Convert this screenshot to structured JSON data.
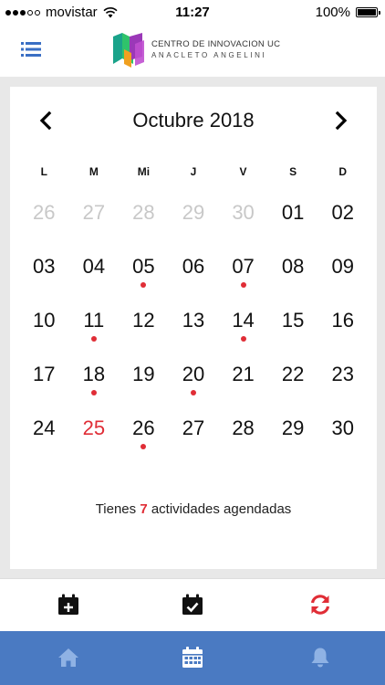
{
  "status_bar": {
    "carrier": "movistar",
    "time": "11:27",
    "battery": "100%",
    "signal_bars_filled": 3,
    "signal_bars_total": 5,
    "battery_level": 1.0
  },
  "header": {
    "menu_icon": "list-menu-icon",
    "logo": {
      "line1": "CENTRO DE INNOVACION UC",
      "line2": "ANACLETO ANGELINI"
    }
  },
  "calendar": {
    "month_title": "Octubre 2018",
    "prev_icon": "chevron-left-icon",
    "next_icon": "chevron-right-icon",
    "weekdays": [
      "L",
      "M",
      "Mi",
      "J",
      "V",
      "S",
      "D"
    ],
    "days": [
      {
        "label": "26",
        "muted": true,
        "event": false,
        "today": false
      },
      {
        "label": "27",
        "muted": true,
        "event": false,
        "today": false
      },
      {
        "label": "28",
        "muted": true,
        "event": false,
        "today": false
      },
      {
        "label": "29",
        "muted": true,
        "event": false,
        "today": false
      },
      {
        "label": "30",
        "muted": true,
        "event": false,
        "today": false
      },
      {
        "label": "01",
        "muted": false,
        "event": false,
        "today": false
      },
      {
        "label": "02",
        "muted": false,
        "event": false,
        "today": false
      },
      {
        "label": "03",
        "muted": false,
        "event": false,
        "today": false
      },
      {
        "label": "04",
        "muted": false,
        "event": false,
        "today": false
      },
      {
        "label": "05",
        "muted": false,
        "event": true,
        "today": false
      },
      {
        "label": "06",
        "muted": false,
        "event": false,
        "today": false
      },
      {
        "label": "07",
        "muted": false,
        "event": true,
        "today": false
      },
      {
        "label": "08",
        "muted": false,
        "event": false,
        "today": false
      },
      {
        "label": "09",
        "muted": false,
        "event": false,
        "today": false
      },
      {
        "label": "10",
        "muted": false,
        "event": false,
        "today": false
      },
      {
        "label": "11",
        "muted": false,
        "event": true,
        "today": false
      },
      {
        "label": "12",
        "muted": false,
        "event": false,
        "today": false
      },
      {
        "label": "13",
        "muted": false,
        "event": false,
        "today": false
      },
      {
        "label": "14",
        "muted": false,
        "event": true,
        "today": false
      },
      {
        "label": "15",
        "muted": false,
        "event": false,
        "today": false
      },
      {
        "label": "16",
        "muted": false,
        "event": false,
        "today": false
      },
      {
        "label": "17",
        "muted": false,
        "event": false,
        "today": false
      },
      {
        "label": "18",
        "muted": false,
        "event": true,
        "today": false
      },
      {
        "label": "19",
        "muted": false,
        "event": false,
        "today": false
      },
      {
        "label": "20",
        "muted": false,
        "event": true,
        "today": false
      },
      {
        "label": "21",
        "muted": false,
        "event": false,
        "today": false
      },
      {
        "label": "22",
        "muted": false,
        "event": false,
        "today": false
      },
      {
        "label": "23",
        "muted": false,
        "event": false,
        "today": false
      },
      {
        "label": "24",
        "muted": false,
        "event": false,
        "today": false
      },
      {
        "label": "25",
        "muted": false,
        "event": false,
        "today": true
      },
      {
        "label": "26",
        "muted": false,
        "event": true,
        "today": false
      },
      {
        "label": "27",
        "muted": false,
        "event": false,
        "today": false
      },
      {
        "label": "28",
        "muted": false,
        "event": false,
        "today": false
      },
      {
        "label": "29",
        "muted": false,
        "event": false,
        "today": false
      },
      {
        "label": "30",
        "muted": false,
        "event": false,
        "today": false
      }
    ],
    "summary": {
      "prefix": "Tienes",
      "count": "7",
      "suffix": "actividades agendadas"
    }
  },
  "actions": [
    {
      "icon": "calendar-add-icon",
      "color": "#111111"
    },
    {
      "icon": "calendar-check-icon",
      "color": "#111111"
    },
    {
      "icon": "refresh-icon",
      "color": "#e02d36"
    }
  ],
  "tabbar": {
    "background": "#4a7ac2",
    "tabs": [
      {
        "icon": "home-icon",
        "active": false
      },
      {
        "icon": "calendar-icon",
        "active": true
      },
      {
        "icon": "bell-icon",
        "active": false
      }
    ]
  },
  "colors": {
    "accent": "#e02d36",
    "muted_day": "#c8c8c8",
    "menu_icon": "#3a6fc4"
  }
}
